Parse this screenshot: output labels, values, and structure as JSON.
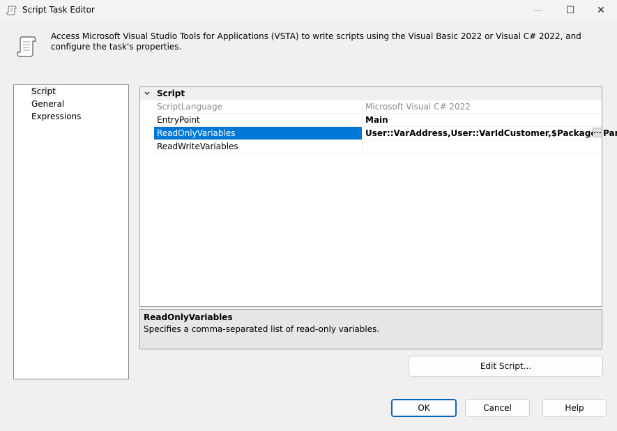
{
  "window": {
    "title": "Script Task Editor",
    "minimize_glyph": "—",
    "maximize_glyph": "☐",
    "close_glyph": "✕"
  },
  "header": {
    "icon": "script-scroll-icon",
    "description": "Access Microsoft Visual Studio Tools for Applications (VSTA) to write scripts using the Visual Basic 2022 or Visual C# 2022, and configure the task's properties."
  },
  "nav": {
    "items": [
      {
        "label": "Script",
        "selected": true
      },
      {
        "label": "General",
        "selected": false
      },
      {
        "label": "Expressions",
        "selected": false
      }
    ]
  },
  "property_grid": {
    "category": "Script",
    "rows": [
      {
        "name": "ScriptLanguage",
        "value": "Microsoft Visual C# 2022",
        "readonly": true
      },
      {
        "name": "EntryPoint",
        "value": "Main",
        "bold": true
      },
      {
        "name": "ReadOnlyVariables",
        "value": "User::VarAddress,User::VarIdCustomer,$Package::ParUrl",
        "bold": true,
        "selected": true
      },
      {
        "name": "ReadWriteVariables",
        "value": ""
      }
    ],
    "ellipsis_label": "..."
  },
  "help": {
    "title": "ReadOnlyVariables",
    "text": "Specifies a comma-separated list of read-only variables."
  },
  "buttons": {
    "edit_script": "Edit Script...",
    "ok": "OK",
    "cancel": "Cancel",
    "help": "Help"
  },
  "colors": {
    "selection": "#0078d7",
    "default_button_border": "#0067c0"
  }
}
